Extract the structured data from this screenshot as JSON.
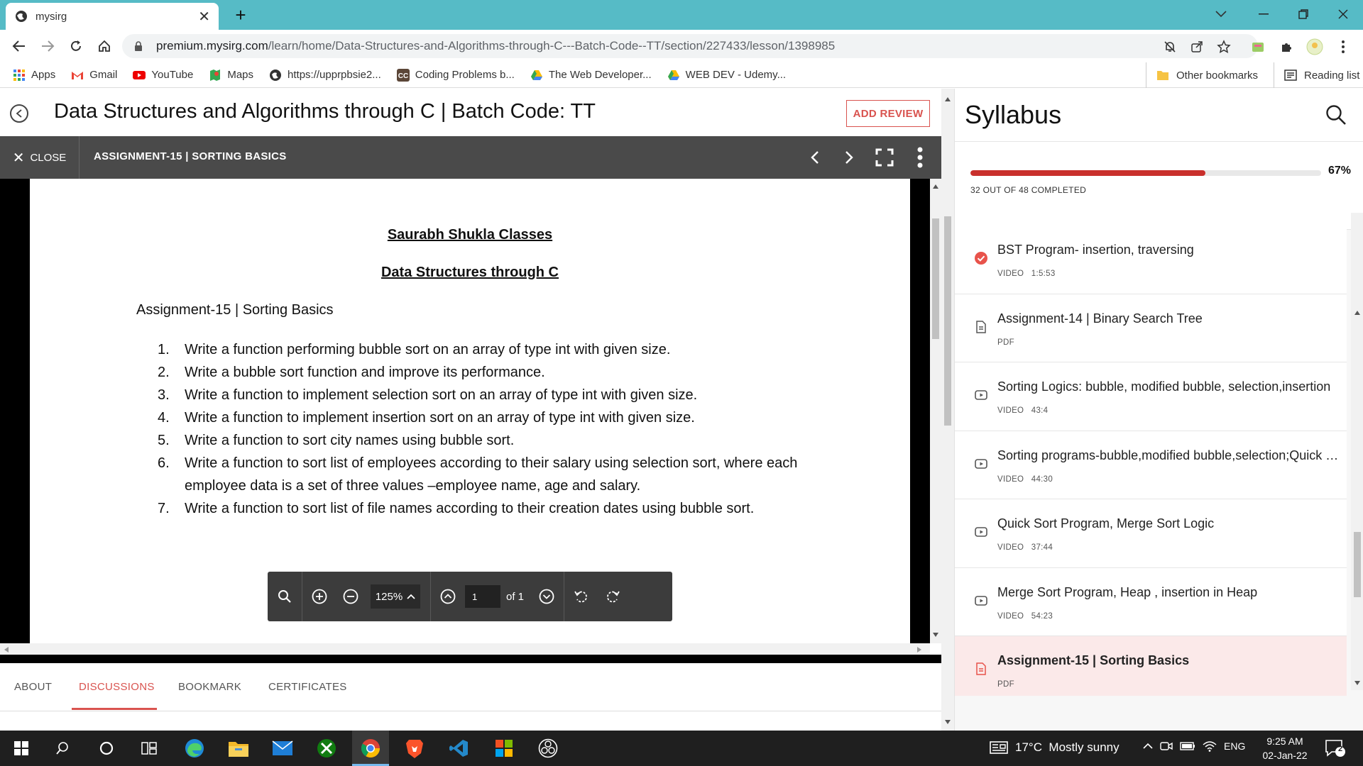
{
  "browser": {
    "tab_title": "mysirg",
    "url_host": "premium.mysirg.com",
    "url_path": "/learn/home/Data-Structures-and-Algorithms-through-C---Batch-Code--TT/section/227433/lesson/1398985",
    "bookmarks": [
      {
        "label": "Apps",
        "icon": "apps-grid-icon"
      },
      {
        "label": "Gmail",
        "icon": "gmail-icon"
      },
      {
        "label": "YouTube",
        "icon": "youtube-icon"
      },
      {
        "label": "Maps",
        "icon": "maps-icon"
      },
      {
        "label": "https://upprpbsie2...",
        "icon": "globe-icon"
      },
      {
        "label": "Coding Problems b...",
        "icon": "codechef-icon"
      },
      {
        "label": "The Web Developer...",
        "icon": "drive-icon"
      },
      {
        "label": "WEB DEV - Udemy...",
        "icon": "drive-icon"
      }
    ],
    "other_bookmarks": "Other bookmarks",
    "reading_list": "Reading list"
  },
  "header": {
    "course_title": "Data Structures and Algorithms through C | Batch Code: TT",
    "add_review": "ADD REVIEW"
  },
  "viewer": {
    "close_label": "CLOSE",
    "lesson_name": "ASSIGNMENT-15 | SORTING BASICS"
  },
  "document": {
    "heading1": "Saurabh Shukla Classes",
    "heading2": "Data Structures through C",
    "heading3": "Assignment-15 | Sorting Basics",
    "items": [
      {
        "n": "1.",
        "text": "Write a function performing bubble sort on an array of type int with given size."
      },
      {
        "n": "2.",
        "text": "Write a bubble sort function and improve its performance."
      },
      {
        "n": "3.",
        "text": "Write a function to implement selection sort on an array of type int with given size."
      },
      {
        "n": "4.",
        "text": "Write a function to implement insertion sort on an array of type int with given size."
      },
      {
        "n": "5.",
        "text": "Write a function to sort city names using bubble sort."
      },
      {
        "n": "6.",
        "text": "Write a function to sort list of employees according to their salary using selection sort, where each employee data is a set of three values –employee name, age and salary."
      },
      {
        "n": "7.",
        "text": "Write a function to sort list of file names according to their creation dates using bubble sort."
      }
    ]
  },
  "pdf_controls": {
    "zoom": "125%",
    "page": "1",
    "of_pages": "of 1"
  },
  "bottom_tabs": [
    {
      "label": "ABOUT",
      "active": false
    },
    {
      "label": "DISCUSSIONS",
      "active": true
    },
    {
      "label": "BOOKMARK",
      "active": false
    },
    {
      "label": "CERTIFICATES",
      "active": false
    }
  ],
  "syllabus": {
    "title": "Syllabus",
    "progress_fraction": 0.67,
    "progress_pct": "67%",
    "progress_count": "32 OUT OF 48 COMPLETED",
    "items": [
      {
        "title": "BST Program- insertion, traversing",
        "sub": "VIDEO   1:5:53",
        "icon": "check-circle-icon",
        "active": false
      },
      {
        "title": "Assignment-14 | Binary Search Tree",
        "sub": "PDF",
        "icon": "document-icon",
        "active": false
      },
      {
        "title": "Sorting Logics: bubble, modified bubble, selection,insertion",
        "sub": "VIDEO   43:4",
        "icon": "video-icon",
        "active": false
      },
      {
        "title": "Sorting programs-bubble,modified bubble,selection;Quick Sort",
        "sub": "VIDEO   44:30",
        "icon": "video-icon",
        "active": false
      },
      {
        "title": "Quick Sort Program, Merge Sort Logic",
        "sub": "VIDEO   37:44",
        "icon": "video-icon",
        "active": false
      },
      {
        "title": "Merge Sort Program, Heap , insertion in Heap",
        "sub": "VIDEO   54:23",
        "icon": "video-icon",
        "active": false
      },
      {
        "title": "Assignment-15 | Sorting Basics",
        "sub": "PDF",
        "icon": "document-icon",
        "active": true
      }
    ]
  },
  "taskbar": {
    "weather": "17°C  Mostly sunny",
    "lang": "ENG",
    "time": "9:25 AM",
    "date": "02-Jan-22",
    "notifications": "2"
  },
  "colors": {
    "accent": "#d9534f",
    "progress": "#c9302c",
    "tabstrip": "#56bbc6",
    "viewer_bar": "#4a4a4a"
  }
}
